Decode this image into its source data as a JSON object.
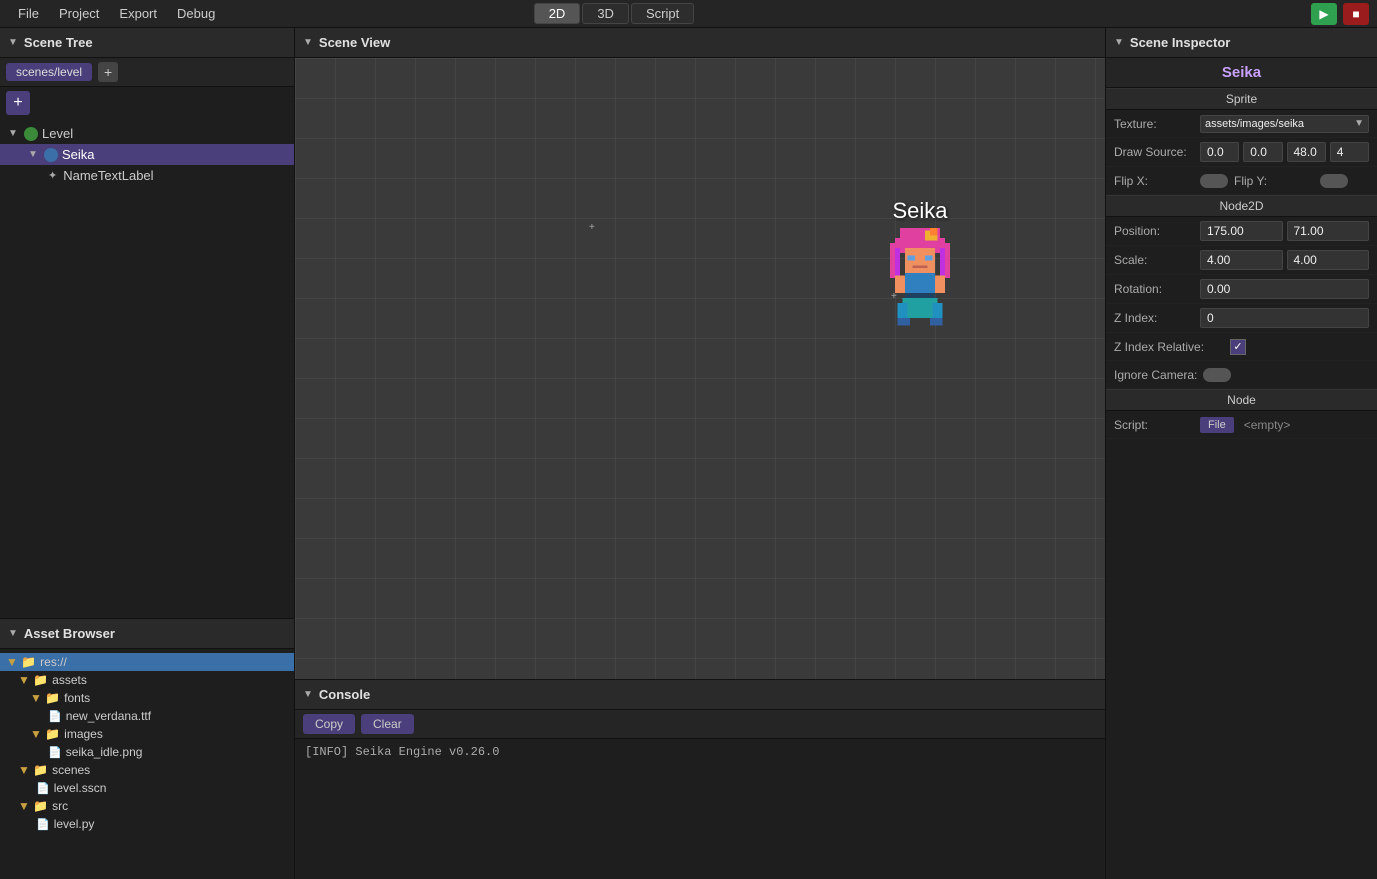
{
  "menubar": {
    "items": [
      "File",
      "Project",
      "Export",
      "Debug"
    ],
    "modes": [
      {
        "label": "2D",
        "active": true
      },
      {
        "label": "3D",
        "active": false
      },
      {
        "label": "Script",
        "active": false
      }
    ],
    "play_label": "▶",
    "stop_label": "■"
  },
  "scene_tree": {
    "title": "Scene Tree",
    "tab": "scenes/level",
    "add_tab_label": "+",
    "add_node_label": "+",
    "nodes": [
      {
        "id": "level",
        "label": "Level",
        "indent": 0,
        "icon": "green",
        "arrow": "▼",
        "selected": false
      },
      {
        "id": "seika",
        "label": "Seika",
        "indent": 1,
        "icon": "blue",
        "arrow": "▼",
        "selected": true
      },
      {
        "id": "nametextlabel",
        "label": "NameTextLabel",
        "indent": 2,
        "icon": "green",
        "arrow": "",
        "selected": false
      }
    ]
  },
  "asset_browser": {
    "title": "Asset Browser",
    "items": [
      {
        "id": "res",
        "label": "res://",
        "type": "folder",
        "indent": 0,
        "arrow": "▼",
        "selected": true
      },
      {
        "id": "assets",
        "label": "assets",
        "type": "folder",
        "indent": 1,
        "arrow": "▼",
        "selected": false
      },
      {
        "id": "fonts",
        "label": "fonts",
        "type": "folder",
        "indent": 2,
        "arrow": "▼",
        "selected": false
      },
      {
        "id": "new_verdana",
        "label": "new_verdana.ttf",
        "type": "file",
        "indent": 3,
        "arrow": "",
        "selected": false
      },
      {
        "id": "images",
        "label": "images",
        "type": "folder",
        "indent": 2,
        "arrow": "▼",
        "selected": false
      },
      {
        "id": "seika_idle",
        "label": "seika_idle.png",
        "type": "file",
        "indent": 3,
        "arrow": "",
        "selected": false
      },
      {
        "id": "scenes",
        "label": "scenes",
        "type": "folder",
        "indent": 1,
        "arrow": "▼",
        "selected": false
      },
      {
        "id": "level_sscn",
        "label": "level.sscn",
        "type": "file",
        "indent": 2,
        "arrow": "",
        "selected": false
      },
      {
        "id": "src",
        "label": "src",
        "type": "folder",
        "indent": 1,
        "arrow": "▼",
        "selected": false
      },
      {
        "id": "level_py",
        "label": "level.py",
        "type": "file",
        "indent": 2,
        "arrow": "",
        "selected": false
      }
    ]
  },
  "scene_view": {
    "title": "Scene View",
    "sprite_name": "Seika"
  },
  "console": {
    "title": "Console",
    "copy_label": "Copy",
    "clear_label": "Clear",
    "log": "[INFO] Seika Engine v0.26.0"
  },
  "inspector": {
    "title": "Scene Inspector",
    "node_name": "Seika",
    "sprite_section": "Sprite",
    "texture_label": "Texture:",
    "texture_value": "assets/images/seika",
    "draw_source_label": "Draw Source:",
    "draw_source_values": [
      "0.0",
      "0.0",
      "48.0",
      "4"
    ],
    "flip_x_label": "Flip X:",
    "flip_y_label": "Flip Y:",
    "node2d_section": "Node2D",
    "position_label": "Position:",
    "position_x": "175.00",
    "position_y": "71.00",
    "scale_label": "Scale:",
    "scale_x": "4.00",
    "scale_y": "4.00",
    "rotation_label": "Rotation:",
    "rotation_value": "0.00",
    "z_index_label": "Z Index:",
    "z_index_value": "0",
    "z_index_relative_label": "Z Index Relative:",
    "ignore_camera_label": "Ignore Camera:",
    "node_section": "Node",
    "script_label": "Script:",
    "script_file_label": "File",
    "script_empty": "<empty>"
  }
}
